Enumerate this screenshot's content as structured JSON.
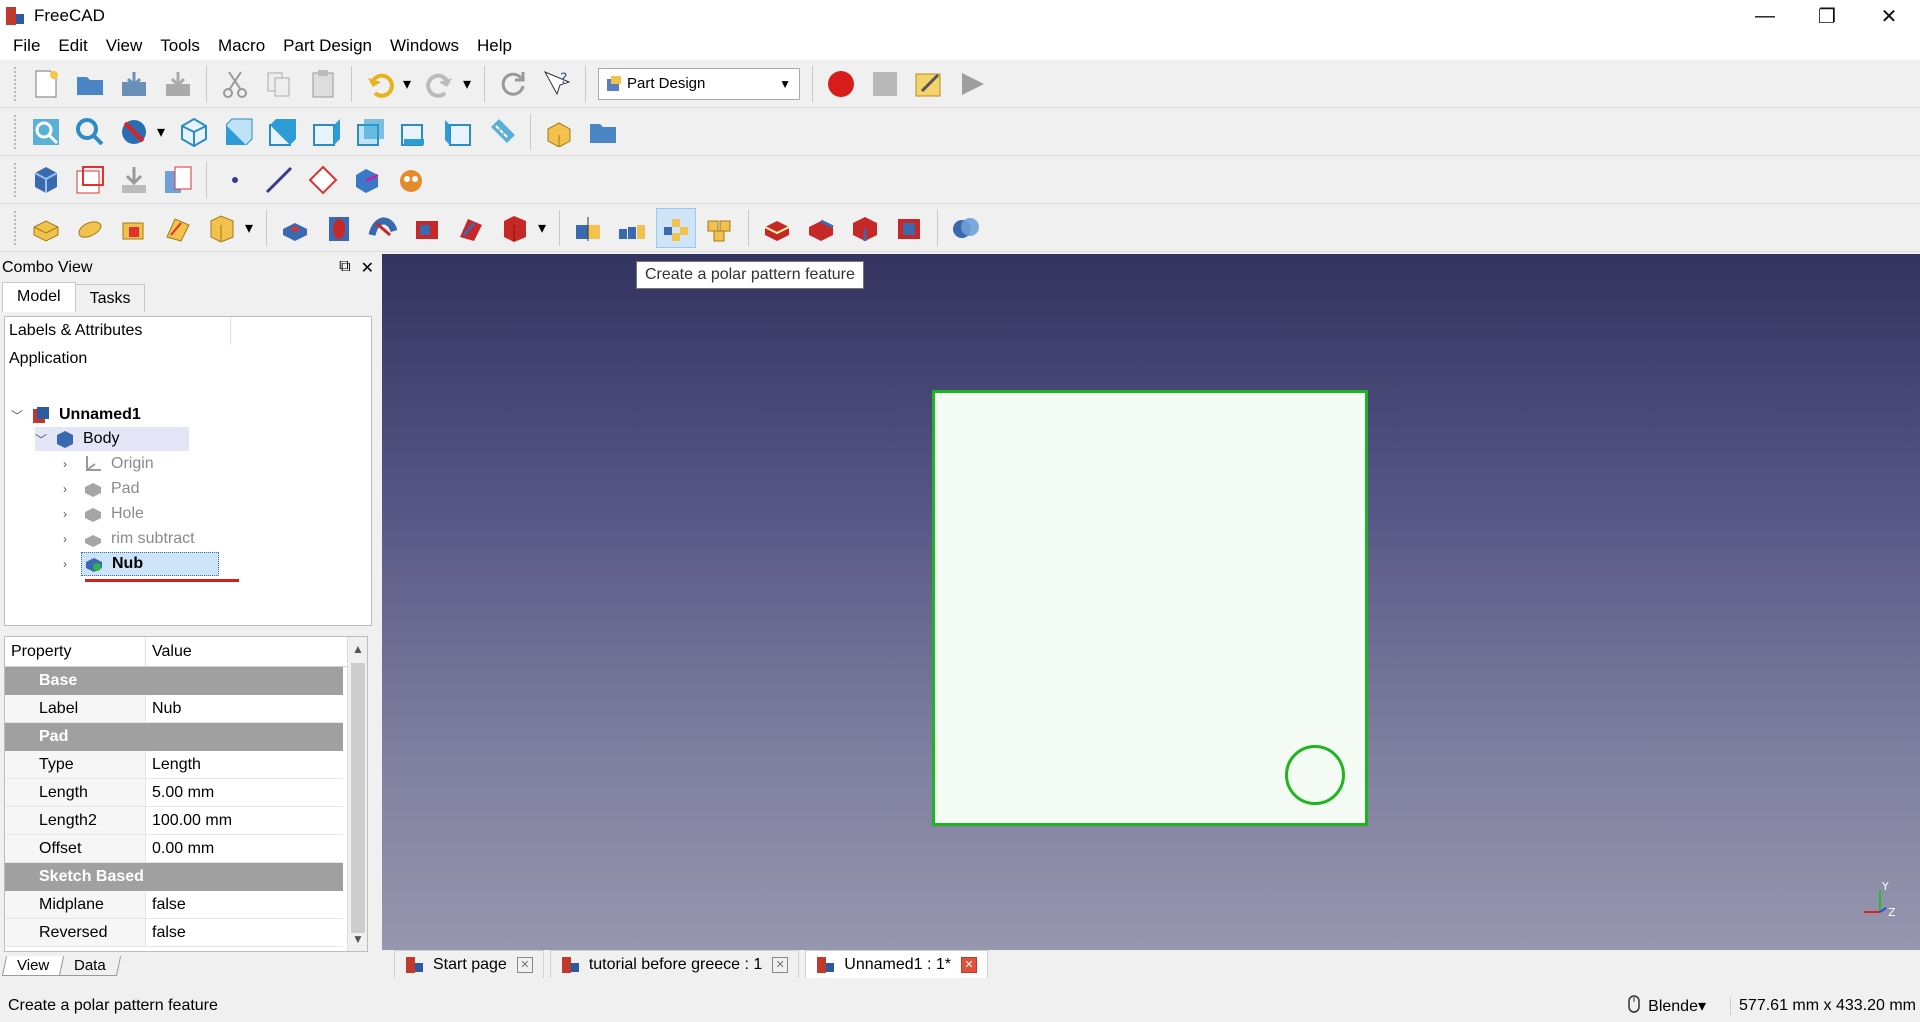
{
  "window": {
    "title": "FreeCAD",
    "minimize": "—",
    "restore": "❐",
    "close": "✕"
  },
  "menu": [
    "File",
    "Edit",
    "View",
    "Tools",
    "Macro",
    "Part Design",
    "Windows",
    "Help"
  ],
  "workbench": {
    "selected": "Part Design"
  },
  "tooltip": "Create a polar pattern feature",
  "combo": {
    "title": "Combo View",
    "tabs": [
      "Model",
      "Tasks"
    ],
    "tree_header": "Labels & Attributes",
    "application": "Application",
    "tree": {
      "doc": "Unnamed1",
      "body": "Body",
      "children": [
        "Origin",
        "Pad",
        "Hole",
        "rim subtract",
        "Nub"
      ]
    }
  },
  "properties": {
    "headers": [
      "Property",
      "Value"
    ],
    "groups": {
      "base": "Base",
      "pad": "Pad",
      "sketch": "Sketch Based"
    },
    "rows": [
      {
        "name": "Label",
        "value": "Nub"
      },
      {
        "name": "Type",
        "value": "Length"
      },
      {
        "name": "Length",
        "value": "5.00 mm"
      },
      {
        "name": "Length2",
        "value": "100.00 mm"
      },
      {
        "name": "Offset",
        "value": "0.00 mm"
      },
      {
        "name": "Midplane",
        "value": "false"
      },
      {
        "name": "Reversed",
        "value": "false"
      }
    ],
    "bottom_tabs": [
      "View",
      "Data"
    ]
  },
  "doc_tabs": [
    "Start page",
    "tutorial before greece : 1",
    "Unnamed1 : 1*"
  ],
  "status": {
    "message": "Create a polar pattern feature",
    "nav_style": "Blende▾",
    "dimensions": "577.61 mm x 433.20 mm"
  },
  "axes": {
    "y": "Y",
    "z": "Z"
  }
}
